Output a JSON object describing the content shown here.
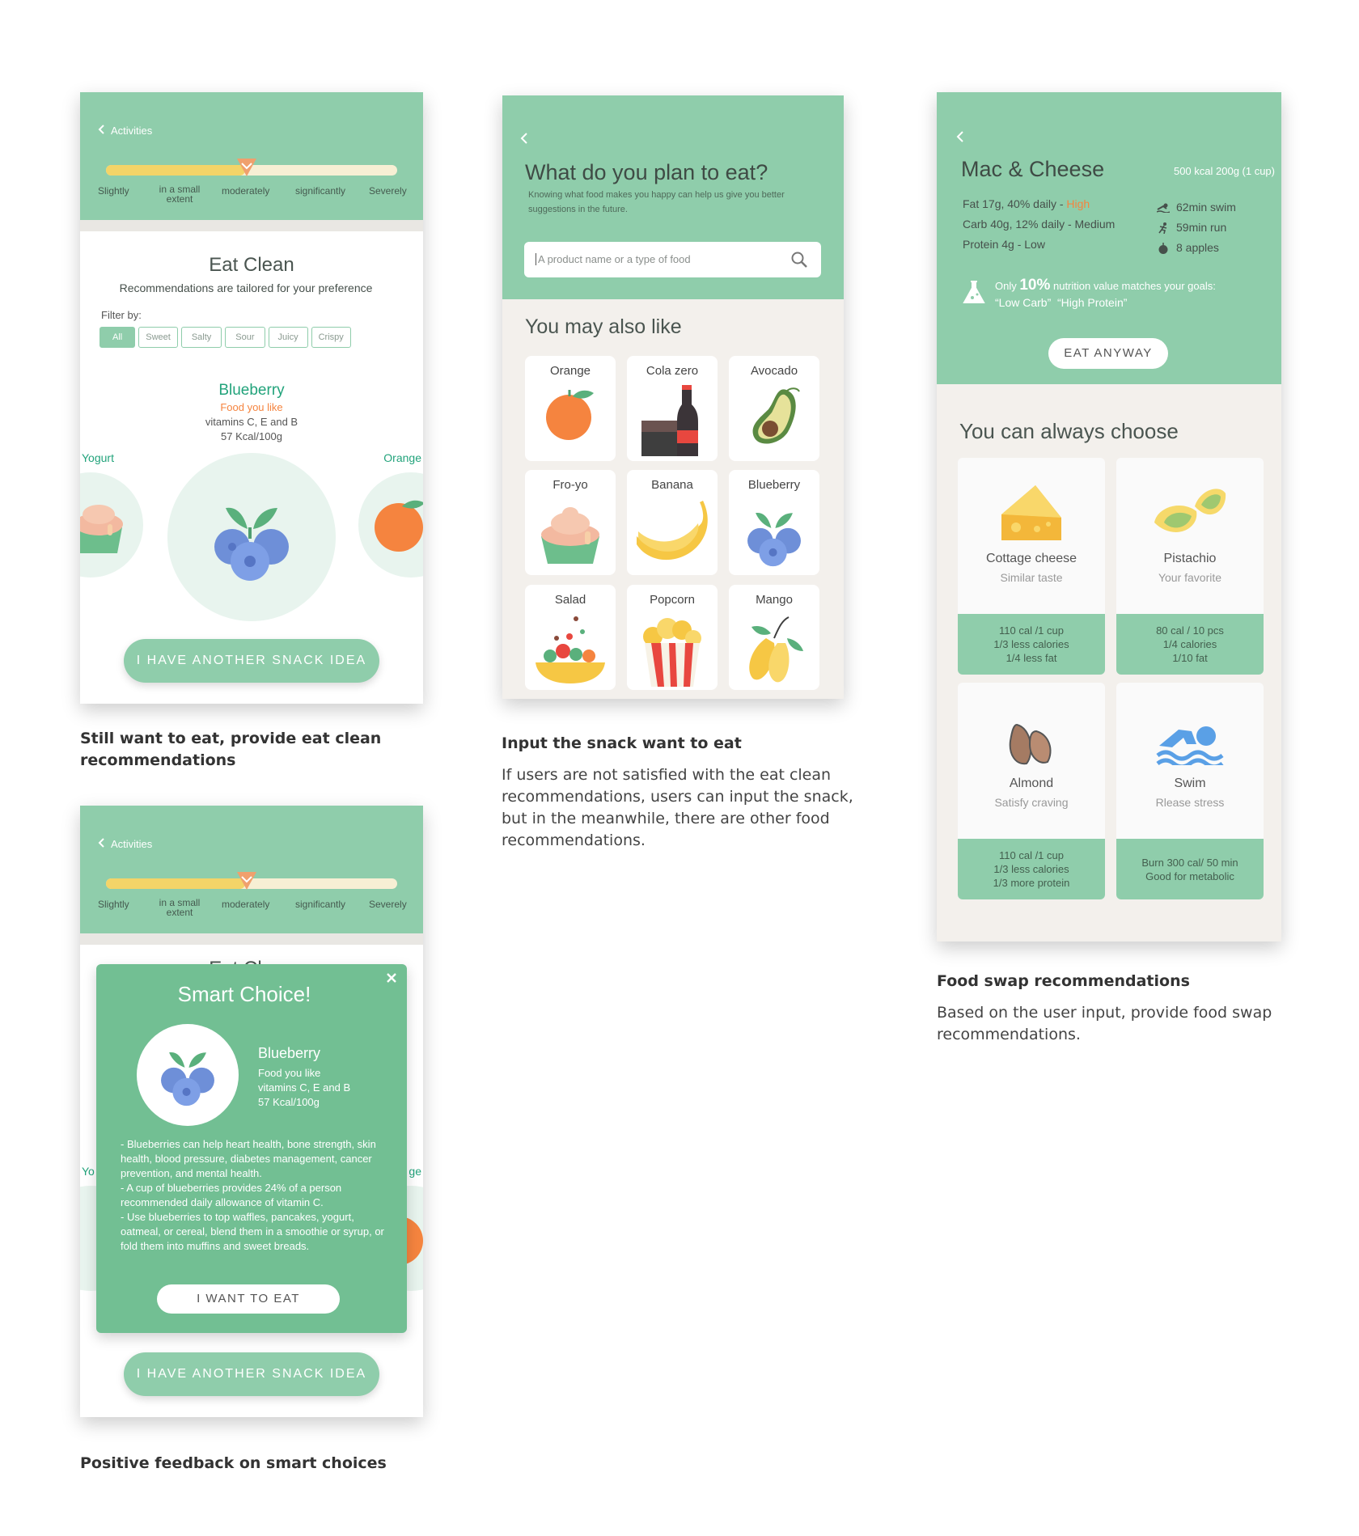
{
  "screen1": {
    "back_label": "Activities",
    "slider_labels": [
      "Slightly",
      "in a small extent",
      "moderately",
      "significantly",
      "Severely"
    ],
    "slider_level": 0.48,
    "title": "Eat Clean",
    "subtitle": "Recommendations are tailored for your preference",
    "filter_label": "Filter by:",
    "filters": [
      "All",
      "Sweet",
      "Salty",
      "Sour",
      "Juicy",
      "Crispy"
    ],
    "food_name": "Blueberry",
    "food_tag": "Food you like",
    "food_vitamins": "vitamins C, E and B",
    "food_kcal": "57 Kcal/100g",
    "left_food": "Yogurt",
    "right_food": "Orange",
    "cta": "I HAVE ANOTHER SNACK IDEA"
  },
  "caption1": {
    "title": "Still want to eat, provide eat clean recommendations"
  },
  "screen2": {
    "title": "What do you plan to eat?",
    "subtitle": "Knowing what food makes you happy can help us give you better suggestions in the future.",
    "search_placeholder": "A product name or a type of food",
    "section_title": "You may also like",
    "foods": [
      "Orange",
      "Cola zero",
      "Avocado",
      "Fro-yo",
      "Banana",
      "Blueberry",
      "Salad",
      "Popcorn",
      "Mango"
    ]
  },
  "caption2": {
    "title": "Input the snack want to eat",
    "body": "If users are not satisfied with the eat clean recommendations, users can input the snack, but in the meanwhile, there are other food recommendations."
  },
  "screen3": {
    "title": "Mac & Cheese",
    "portion": "500 kcal 200g (1 cup)",
    "fat_text": "Fat  17g, 40% daily - ",
    "fat_level": "High",
    "carb_text": "Carb 40g, 12% daily - Medium",
    "protein_text": "Protein 4g - Low",
    "swim": "62min swim",
    "run": "59min run",
    "apples": "8 apples",
    "match_prefix": "Only ",
    "match_pct": "10%",
    "match_suffix": " nutrition value matches your goals:",
    "goals": "“Low Carb”  “High Protein”",
    "eat_anyway": "EAT ANYWAY",
    "section_title": "You can always choose",
    "swaps": [
      {
        "name": "Cottage cheese",
        "sub": "Similar taste",
        "lines": [
          "110 cal /1 cup",
          "1/3 less calories",
          "1/4 less fat"
        ]
      },
      {
        "name": "Pistachio",
        "sub": "Your favorite",
        "lines": [
          "80 cal / 10 pcs",
          "1/4 calories",
          "1/10 fat"
        ]
      },
      {
        "name": "Almond",
        "sub": "Satisfy craving",
        "lines": [
          "110 cal /1 cup",
          "1/3 less calories",
          "1/3 more protein"
        ]
      },
      {
        "name": "Swim",
        "sub": "Rlease stress",
        "lines": [
          "Burn 300 cal/ 50 min",
          "Good for metabolic"
        ]
      }
    ]
  },
  "caption3": {
    "title": "Food swap recommendations",
    "body": "Based on the user input, provide food swap recommendations."
  },
  "screen4": {
    "back_label": "Activities",
    "slider_labels": [
      "Slightly",
      "in a small extent",
      "moderately",
      "significantly",
      "Severely"
    ],
    "peek_title": "Eat Clean",
    "peek_left": "Yo",
    "peek_right": "ge",
    "modal_title": "Smart Choice!",
    "food_name": "Blueberry",
    "food_tag": "Food you like",
    "food_vitamins": "vitamins C, E and B",
    "food_kcal": "57 Kcal/100g",
    "facts": "- Blueberries can help heart health, bone strength, skin health, blood pressure, diabetes management, cancer prevention, and mental health.\n- A cup of blueberries provides 24% of a person recommended daily allowance of vitamin C.\n- Use blueberries to top waffles, pancakes, yogurt, oatmeal, or cereal, blend them in a smoothie or syrup, or fold them into muffins and sweet breads.",
    "modal_cta": "I WANT TO EAT",
    "cta": "I HAVE ANOTHER SNACK IDEA"
  },
  "caption4": {
    "title": "Positive feedback on smart choices"
  },
  "colors": {
    "brand_green": "#8fcdab",
    "modal_green": "#72bf93",
    "accent_orange": "#f5843f",
    "text_teal": "#22a37b"
  }
}
